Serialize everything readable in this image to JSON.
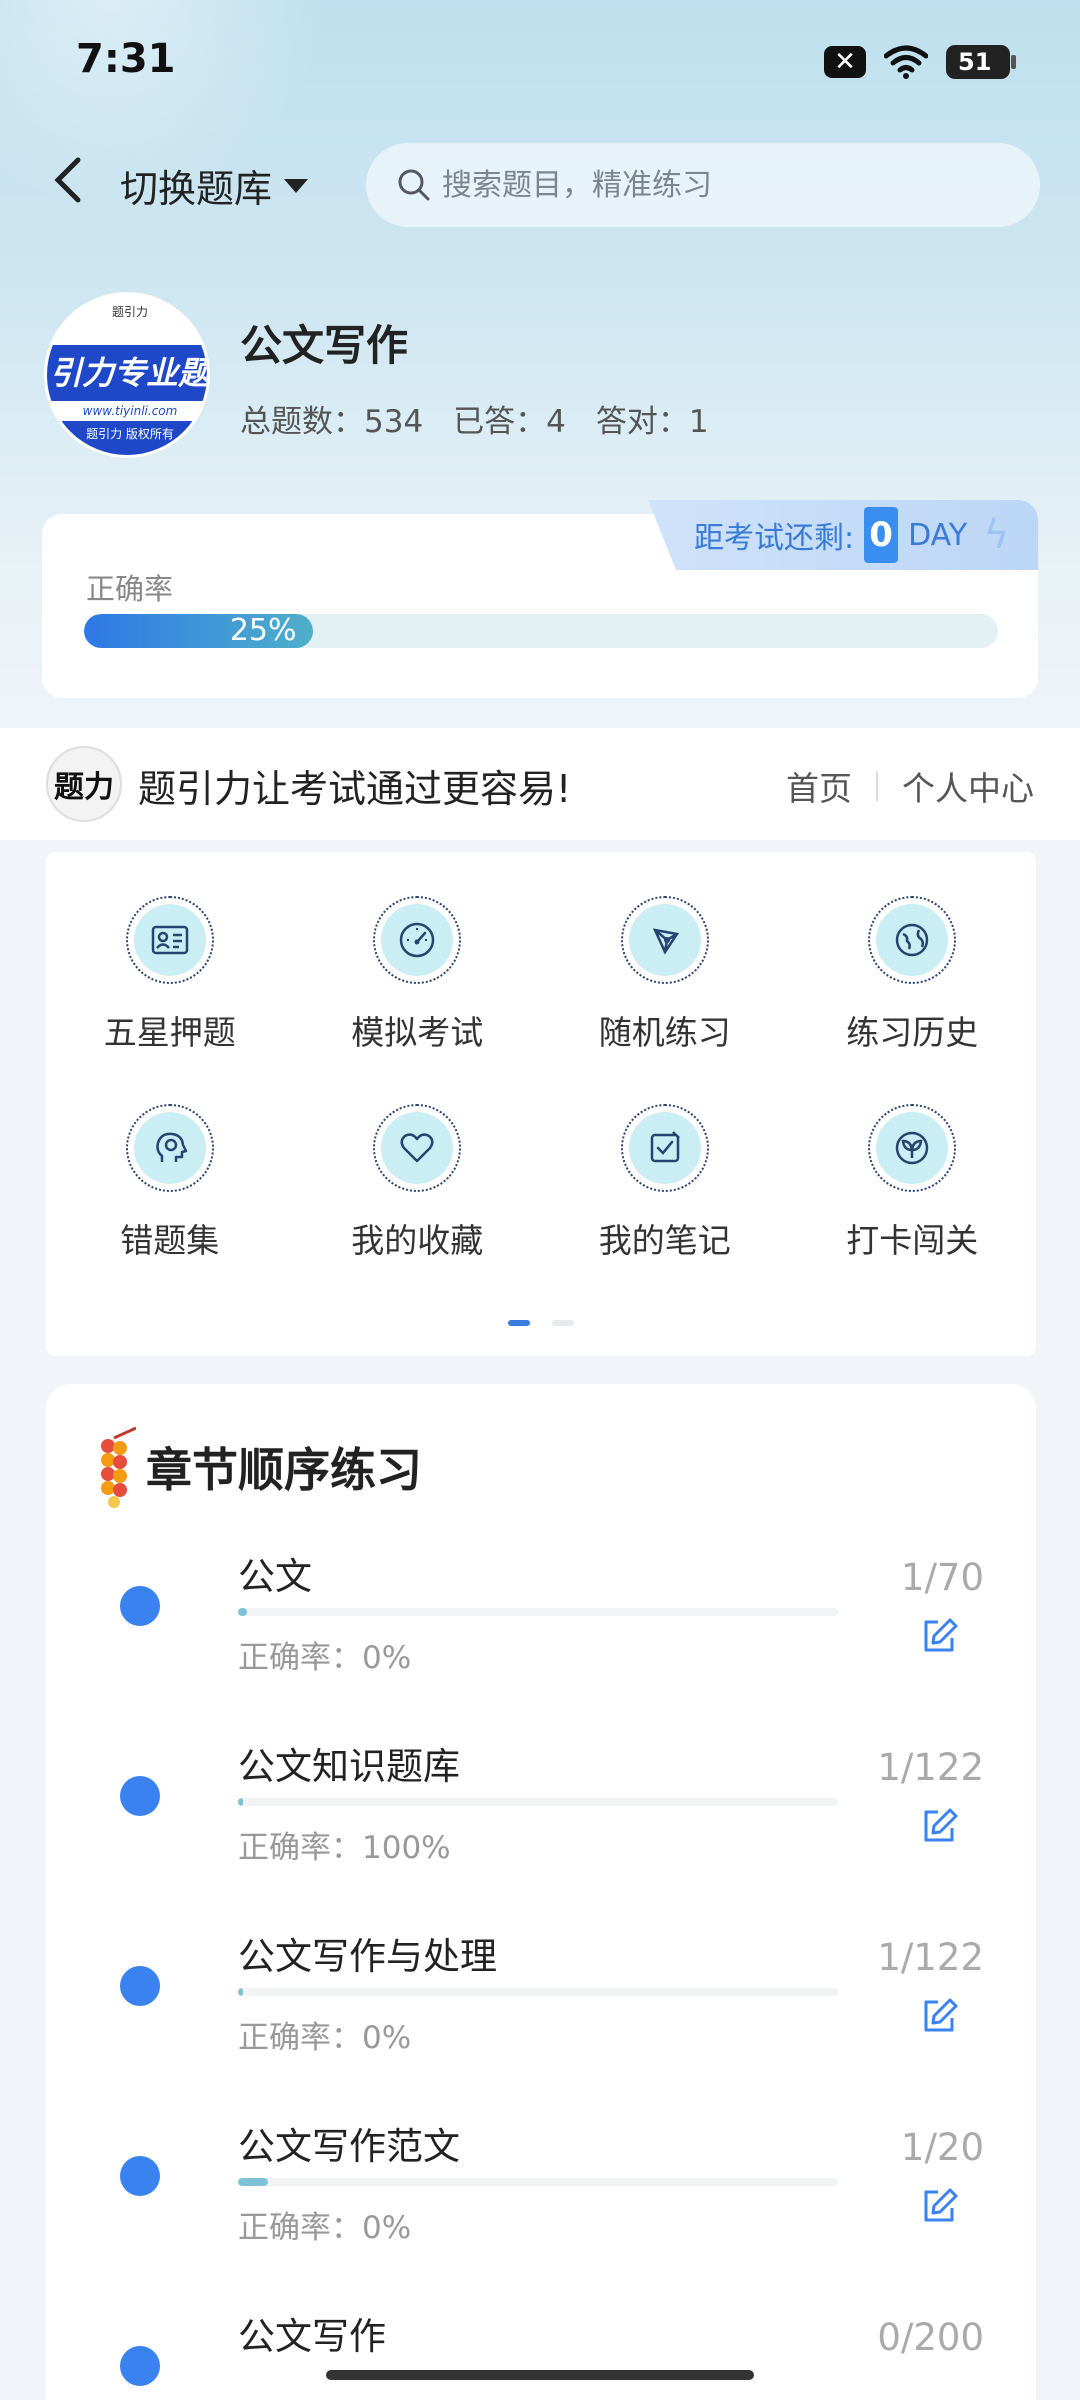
{
  "status_bar": {
    "time": "7:31",
    "battery": "51"
  },
  "nav": {
    "switch_bank_label": "切换题库",
    "search_placeholder": "搜索题目，精准练习"
  },
  "book": {
    "title": "公文写作",
    "logo_band_text": "引力专业题",
    "logo_url_text": "www.tiyinli.com",
    "logo_bottom_text": "题引力 版权所有",
    "stats": {
      "total": "总题数：534",
      "answered": "已答：4",
      "correct": "答对：1"
    }
  },
  "accuracy_card": {
    "label": "正确率",
    "percent": 25,
    "percent_text": "25%",
    "countdown_label": "距考试还剩:",
    "countdown_days": "0",
    "countdown_unit": "DAY"
  },
  "slogan": {
    "text": "题引力让考试通过更容易!",
    "home_link": "首页",
    "profile_link": "个人中心"
  },
  "menu": {
    "items": [
      {
        "label": "五星押题",
        "icon": "id-card-icon"
      },
      {
        "label": "模拟考试",
        "icon": "gauge-icon"
      },
      {
        "label": "随机练习",
        "icon": "network-icon"
      },
      {
        "label": "练习历史",
        "icon": "globe-icon"
      },
      {
        "label": "错题集",
        "icon": "head-icon"
      },
      {
        "label": "我的收藏",
        "icon": "heart-icon"
      },
      {
        "label": "我的笔记",
        "icon": "note-check-icon"
      },
      {
        "label": "打卡闯关",
        "icon": "sprout-icon"
      }
    ],
    "page_count": 2,
    "active_page": 1
  },
  "chapters": {
    "title": "章节顺序练习",
    "items": [
      {
        "name": "公文",
        "progress": "1/70",
        "rate": "正确率：0%",
        "fill": 0.0143
      },
      {
        "name": "公文知识题库",
        "progress": "1/122",
        "rate": "正确率：100%",
        "fill": 0.0082
      },
      {
        "name": "公文写作与处理",
        "progress": "1/122",
        "rate": "正确率：0%",
        "fill": 0.0082
      },
      {
        "name": "公文写作范文",
        "progress": "1/20",
        "rate": "正确率：0%",
        "fill": 0.05
      },
      {
        "name": "公文写作",
        "progress": "0/200",
        "rate": "",
        "fill": 0
      }
    ]
  },
  "colors": {
    "accent": "#3a82f0",
    "progress_fill": "#7ec2d8",
    "icon_bg": "#cbeef4"
  }
}
